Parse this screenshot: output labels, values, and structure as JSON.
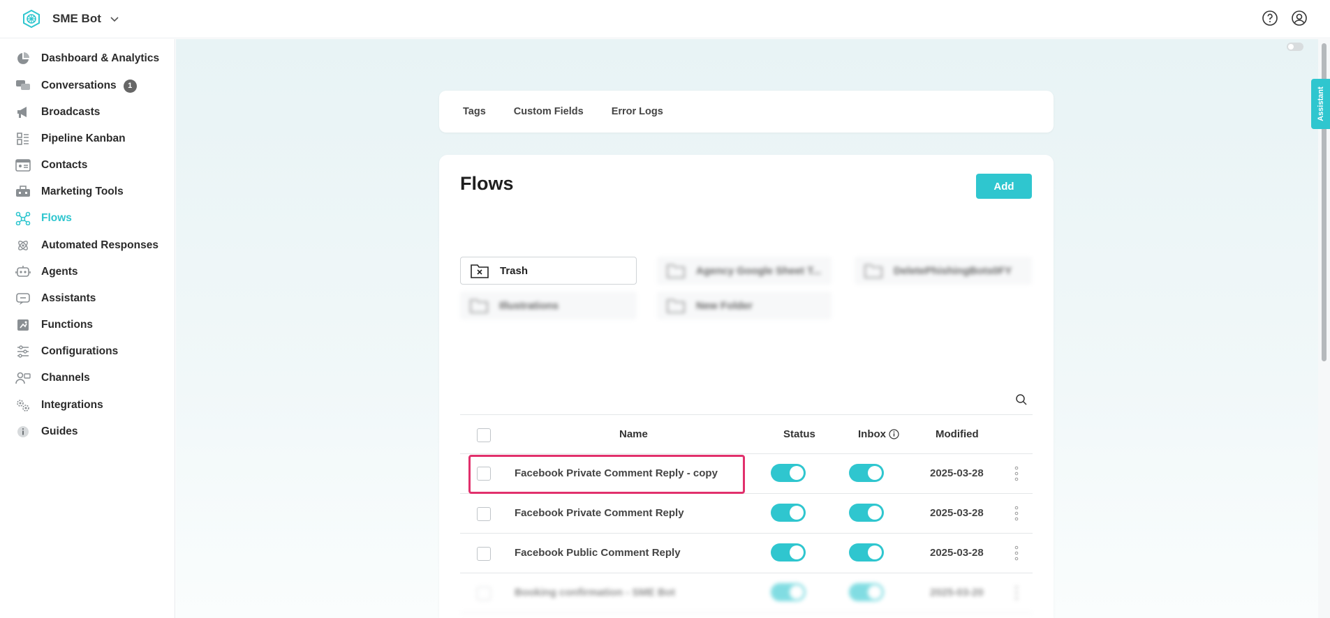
{
  "header": {
    "app_name": "SME Bot",
    "logo_icon": "brain-hex-icon",
    "help_icon": "help-circle-icon",
    "account_icon": "user-circle-icon"
  },
  "sidebar": {
    "items": [
      {
        "label": "Dashboard & Analytics",
        "icon": "pie-chart-icon"
      },
      {
        "label": "Conversations",
        "icon": "chat-bubbles-icon",
        "badge": "1"
      },
      {
        "label": "Broadcasts",
        "icon": "megaphone-icon"
      },
      {
        "label": "Pipeline Kanban",
        "icon": "kanban-icon"
      },
      {
        "label": "Contacts",
        "icon": "contact-card-icon"
      },
      {
        "label": "Marketing Tools",
        "icon": "toolbox-icon"
      },
      {
        "label": "Flows",
        "icon": "flow-nodes-icon",
        "active": true
      },
      {
        "label": "Automated Responses",
        "icon": "atom-icon"
      },
      {
        "label": "Agents",
        "icon": "robot-icon"
      },
      {
        "label": "Assistants",
        "icon": "assistant-icon"
      },
      {
        "label": "Functions",
        "icon": "function-icon"
      },
      {
        "label": "Configurations",
        "icon": "sliders-icon"
      },
      {
        "label": "Channels",
        "icon": "channels-icon"
      },
      {
        "label": "Integrations",
        "icon": "gears-icon"
      },
      {
        "label": "Guides",
        "icon": "info-icon"
      }
    ]
  },
  "tabs": [
    "Tags",
    "Custom Fields",
    "Error Logs"
  ],
  "assistant_tab": "Assistant",
  "flows": {
    "title": "Flows",
    "add_label": "Add",
    "folders": [
      {
        "label": "Trash",
        "icon": "trash-folder-icon"
      },
      {
        "label": "Agency Google Sheet T...",
        "icon": "folder-icon"
      },
      {
        "label": "DeletePhishingBots0FY",
        "icon": "folder-icon"
      },
      {
        "label": "Illustrations",
        "icon": "folder-icon"
      },
      {
        "label": "New Folder",
        "icon": "folder-icon"
      }
    ],
    "table": {
      "columns": {
        "name": "Name",
        "status": "Status",
        "inbox": "Inbox",
        "modified": "Modified"
      },
      "rows": [
        {
          "name": "Facebook Private Comment Reply - copy",
          "status": true,
          "inbox": true,
          "modified": "2025-03-28"
        },
        {
          "name": "Facebook Private Comment Reply",
          "status": true,
          "inbox": true,
          "modified": "2025-03-28"
        },
        {
          "name": "Facebook Public Comment Reply",
          "status": true,
          "inbox": true,
          "modified": "2025-03-28"
        },
        {
          "name": "Booking confirmation - SME Bot",
          "status": true,
          "inbox": true,
          "modified": "2025-03-20"
        }
      ]
    }
  },
  "colors": {
    "accent": "#2fc6cf",
    "highlight": "#e1306c"
  }
}
